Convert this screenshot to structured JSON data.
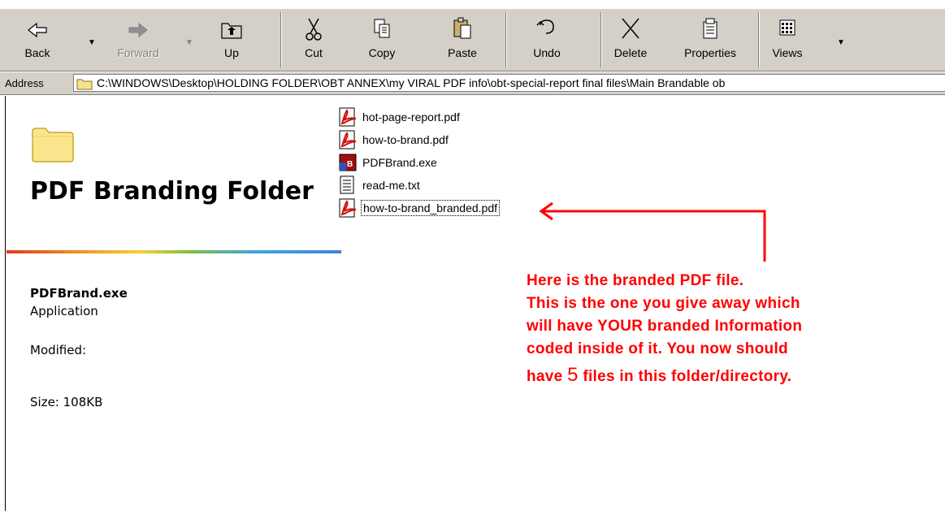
{
  "toolbar": {
    "back_label": "Back",
    "forward_label": "Forward",
    "up_label": "Up",
    "cut_label": "Cut",
    "copy_label": "Copy",
    "paste_label": "Paste",
    "undo_label": "Undo",
    "delete_label": "Delete",
    "properties_label": "Properties",
    "views_label": "Views"
  },
  "address": {
    "label": "Address",
    "value": "C:\\WINDOWS\\Desktop\\HOLDING FOLDER\\OBT ANNEX\\my VIRAL PDF info\\obt-special-report final files\\Main Brandable ob"
  },
  "info_panel": {
    "folder_title": "PDF Branding Folder",
    "selected_name": "PDFBrand.exe",
    "selected_type": "Application",
    "modified_label": "Modified:",
    "size_text": "Size: 108KB"
  },
  "files": [
    {
      "name": "hot-page-report.pdf",
      "icon": "pdf-icon"
    },
    {
      "name": "how-to-brand.pdf",
      "icon": "pdf-icon"
    },
    {
      "name": "PDFBrand.exe",
      "icon": "exe-icon"
    },
    {
      "name": "read-me.txt",
      "icon": "txt-icon"
    },
    {
      "name": "how-to-brand_branded.pdf",
      "icon": "pdf-icon"
    }
  ],
  "annotation": {
    "line1": "Here is the branded PDF file.",
    "line2": "This is the one you give away which",
    "line3": "will have YOUR branded Information",
    "line4": "coded inside of it. You now should",
    "line5_pre": "have ",
    "line5_num": "5",
    "line5_post": " files in this folder/directory."
  },
  "colors": {
    "annotation": "#ff0000",
    "toolbar_bg": "#d4d0c8"
  }
}
